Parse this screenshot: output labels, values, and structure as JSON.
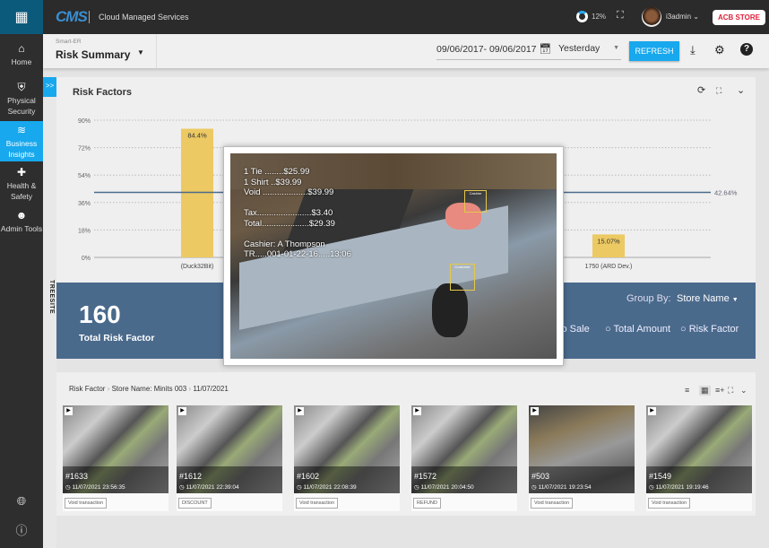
{
  "topbar": {
    "apps_icon": "grid-icon",
    "logo": "CMS",
    "title": "Cloud Managed Services",
    "cpu_value": "12%",
    "cpu_fraction": 0.12,
    "fullscreen_icon": "fullscreen-icon",
    "username": "i3admin",
    "store_badge": "ACB STORE",
    "accent": "#17a8ee",
    "store_color": "#e0203a"
  },
  "sidebar": {
    "items": [
      {
        "label": "Home",
        "icon": "home-icon"
      },
      {
        "label": "Physical Security",
        "icon": "shield-icon"
      },
      {
        "label": "Business Insights",
        "icon": "trend-icon",
        "active": true
      },
      {
        "label": "Health & Safety",
        "icon": "plus-icon"
      },
      {
        "label": "Admin Tools",
        "icon": "user-icon"
      }
    ],
    "bottom_icons": [
      "globe-icon",
      "info-icon"
    ]
  },
  "header": {
    "crumb": "Smart-ER",
    "title": "Risk Summary",
    "date_range": "09/06/2017- 09/06/2017",
    "range": "Yesterday",
    "refresh": "REFRESH"
  },
  "treesite": {
    "label": "TREESITE",
    "toggle": ">>"
  },
  "risk_factors": {
    "title": "Risk Factors"
  },
  "chart_data": {
    "type": "bar",
    "yticks": [
      "90%",
      "72%",
      "54%",
      "36%",
      "18%",
      "0%"
    ],
    "ylim": [
      0,
      90
    ],
    "categories": [
      "(Duck32Bit)",
      "1750 (ARD Dev.)"
    ],
    "values": [
      84.4,
      15.07
    ],
    "data_labels": [
      "84.4%",
      "15.07%"
    ],
    "average": 42.64,
    "average_label": "42.64%",
    "bar_color": "#ecc963",
    "grid": true
  },
  "summary": {
    "total": "160",
    "total_label": "Total Risk Factor",
    "group_by_label": "Group By:",
    "group_by_value": "Store Name",
    "radios": [
      "To Sale",
      "Total Amount",
      "Risk Factor"
    ]
  },
  "popup": {
    "receipt": "1 Tie ........$25.99\n1 Shirt ..$39.99\nVoid ...................$39.99\n\nTax.......................$3.40\nTotal....................$29.39\n\nCashier: A Thompson\nTR.....001-01-22-16.....13:06",
    "cashier_box": "Cashier",
    "customer_box": "Customer"
  },
  "events": {
    "breadcrumb": [
      "Risk Factor",
      "Store Name: Minits 003",
      "11/07/2021"
    ],
    "cards": [
      {
        "id": "#1633",
        "time": "11/07/2021 23:56:35",
        "tag": "Void transaction"
      },
      {
        "id": "#1612",
        "time": "11/07/2021 22:39:04",
        "tag": "DISCOUNT"
      },
      {
        "id": "#1602",
        "time": "11/07/2021 22:08:39",
        "tag": "Void transaction"
      },
      {
        "id": "#1572",
        "time": "11/07/2021 20:04:50",
        "tag": "REFUND"
      },
      {
        "id": "#503",
        "time": "11/07/2021 19:23:54",
        "tag": "Void transaction"
      },
      {
        "id": "#1549",
        "time": "11/07/2021 19:19:46",
        "tag": "Void transaction"
      }
    ]
  }
}
